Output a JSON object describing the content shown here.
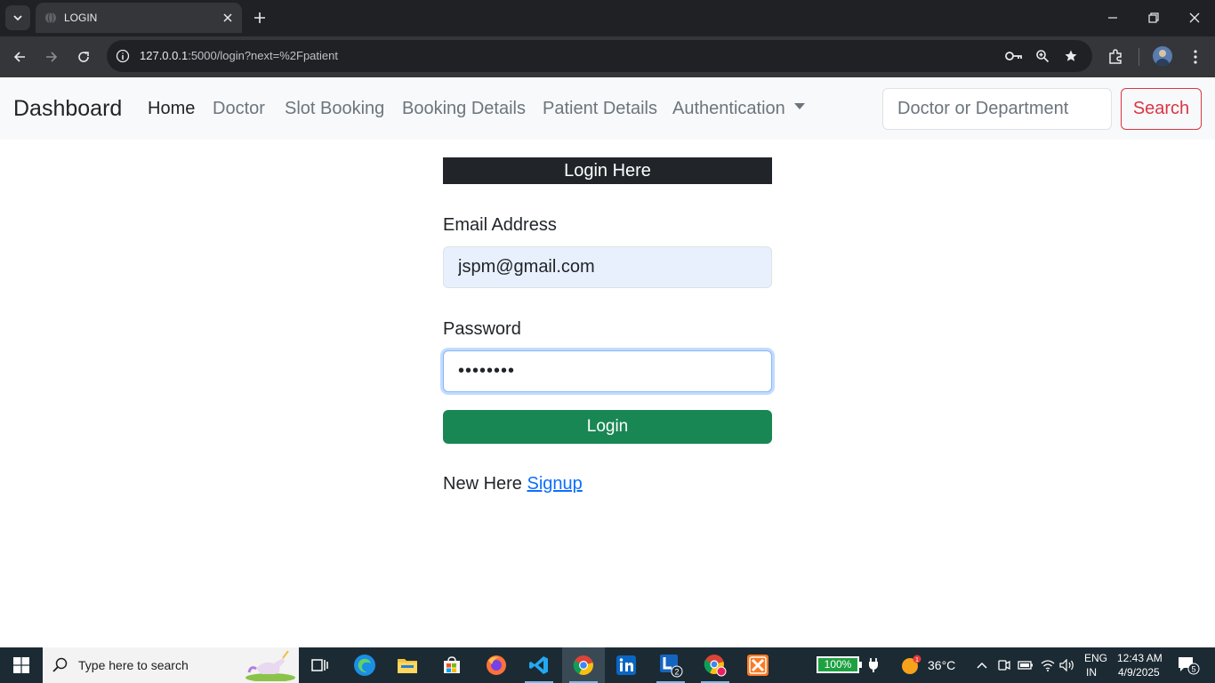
{
  "browser": {
    "tab_title": "LOGIN",
    "url_host": "127.0.0.1",
    "url_rest": ":5000/login?next=%2Fpatient"
  },
  "navbar": {
    "brand": "Dashboard",
    "links": [
      "Home",
      "Doctor",
      "Slot Booking",
      "Booking Details",
      "Patient Details",
      "Authentication"
    ],
    "active_link": "Home",
    "search_placeholder": "Doctor or Department",
    "search_button": "Search"
  },
  "login": {
    "header": "Login Here",
    "email_label": "Email Address",
    "email_value": "jspm@gmail.com",
    "password_label": "Password",
    "password_value": "••••••••",
    "login_button": "Login",
    "new_here_text": "New Here",
    "signup_link": "Signup"
  },
  "taskbar": {
    "search_placeholder": "Type here to search",
    "battery": "100%",
    "weather": "36°C",
    "weather_badge": "1",
    "language_line1": "ENG",
    "language_line2": "IN",
    "time": "12:43 AM",
    "date": "4/9/2025",
    "notification_count": "5",
    "lens_badge": "2"
  },
  "colors": {
    "login_button": "#198754",
    "search_button": "#dc3545",
    "header_bg": "#212529",
    "link": "#0d6efd"
  }
}
